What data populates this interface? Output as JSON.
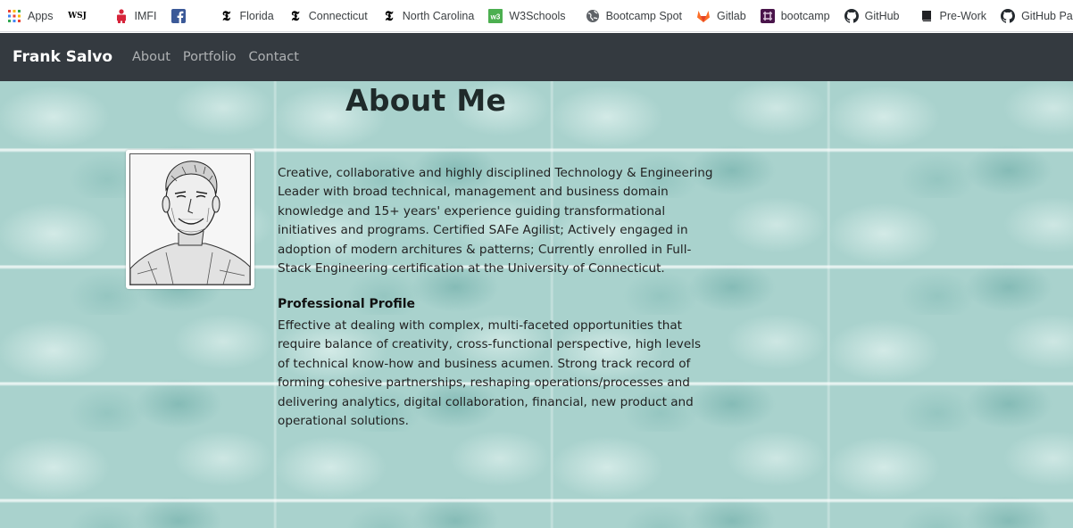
{
  "bookmarks": [
    {
      "label": "Apps",
      "icon": "apps-grid-icon"
    },
    {
      "label": "",
      "icon": "wsj-icon",
      "icon_text": "WSJ"
    },
    {
      "label": "IMFI",
      "icon": "imfi-icon"
    },
    {
      "label": "",
      "icon": "facebook-icon"
    },
    {
      "label": "Florida",
      "icon": "nyt-icon"
    },
    {
      "label": "Connecticut",
      "icon": "nyt-icon"
    },
    {
      "label": "North Carolina",
      "icon": "nyt-icon"
    },
    {
      "label": "W3Schools",
      "icon": "w3schools-icon"
    },
    {
      "label": "Bootcamp Spot",
      "icon": "globe-icon"
    },
    {
      "label": "Gitlab",
      "icon": "gitlab-icon"
    },
    {
      "label": "bootcamp",
      "icon": "slack-icon"
    },
    {
      "label": "GitHub",
      "icon": "github-icon"
    },
    {
      "label": "Pre-Work",
      "icon": "book-icon"
    },
    {
      "label": "GitHub Pages | W",
      "icon": "github-icon"
    }
  ],
  "navbar": {
    "brand": "Frank Salvo",
    "links": [
      "About",
      "Portfolio",
      "Contact"
    ]
  },
  "main": {
    "title": "About Me",
    "bio": "Creative, collaborative and highly disciplined Technology & Engineering Leader with broad technical, management and business domain knowledge and 15+ years' experience guiding transformational initiatives and programs. Certified SAFe Agilist; Actively engaged in adoption of modern architures & patterns; Currently enrolled in Full-Stack Engineering certification at the University of Connecticut.",
    "profile_heading": "Professional Profile",
    "profile_text": "Effective at dealing with complex, multi-faceted opportunities that require balance of creativity, cross-functional perspective, high levels of technical know-how and business acumen. Strong track record of forming cohesive partnerships, reshaping operations/processes and delivering analytics, digital collaboration, financial, new product and operational solutions."
  },
  "colors": {
    "navbar_bg": "#343a40",
    "background_teal": "#a9d2cd"
  }
}
